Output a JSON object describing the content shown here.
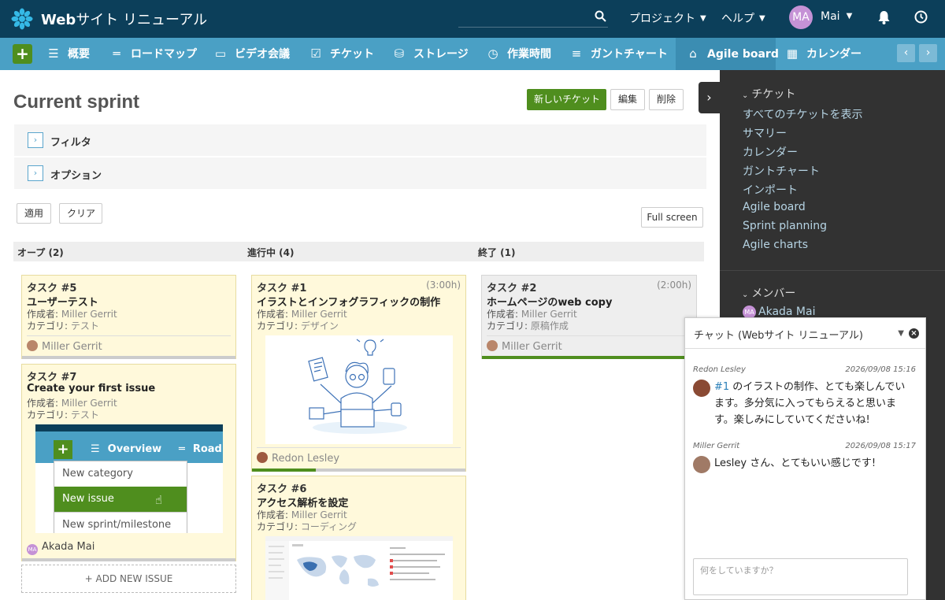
{
  "app": {
    "title_bold": "Web",
    "title_rest": "サイト リニューアル"
  },
  "header": {
    "nav_projects": "プロジェクト",
    "nav_help": "ヘルプ",
    "user_initials": "MA",
    "user_name": "Mai",
    "icons": [
      "search-icon",
      "bell-icon",
      "clock-icon"
    ]
  },
  "main_nav": {
    "add_label": "+",
    "tabs": [
      {
        "label": "概要",
        "icon": "list-icon"
      },
      {
        "label": "ロードマップ",
        "icon": "roadmap-icon"
      },
      {
        "label": "ビデオ会議",
        "icon": "video-icon"
      },
      {
        "label": "チケット",
        "icon": "checkbox-icon"
      },
      {
        "label": "ストレージ",
        "icon": "database-icon"
      },
      {
        "label": "作業時間",
        "icon": "clock-icon"
      },
      {
        "label": "ガントチャート",
        "icon": "gantt-icon"
      },
      {
        "label": "Agile board",
        "icon": "agile-icon",
        "active": true
      },
      {
        "label": "カレンダー",
        "icon": "calendar-icon"
      }
    ]
  },
  "page": {
    "title": "Current sprint",
    "new_ticket": "新しいチケット",
    "edit": "編集",
    "delete": "削除",
    "filter_label": "フィルタ",
    "options_label": "オプション",
    "apply": "適用",
    "clear": "クリア",
    "full_screen": "Full screen"
  },
  "board": {
    "columns": [
      "オープ (2)",
      "進行中 (4)",
      "終了 (1)"
    ],
    "author_label": "作成者: ",
    "category_label": "カテゴリ: ",
    "add_new_issue": "+ ADD NEW ISSUE",
    "cards": [
      {
        "tracker": "タスク #5",
        "subject": "ユーザーテスト",
        "author": "Miller Gerrit",
        "category": "テスト",
        "assignee": "Miller Gerrit",
        "done_ratio": 0
      },
      {
        "tracker": "タスク #7",
        "subject": "Create your first issue",
        "author": "Miller Gerrit",
        "category": "テスト",
        "assignee": "Akada Mai",
        "done_ratio": 0,
        "image": {
          "nav_label": "Overview",
          "nav_label2": "Road",
          "menu": [
            "New category",
            "New issue",
            "New sprint/milestone"
          ]
        }
      },
      {
        "tracker": "タスク #1",
        "subject": "イラストとインフォグラフィックの制作",
        "estimate": "(3:00h)",
        "author": "Miller Gerrit",
        "category": "デザイン",
        "assignee": "Redon Lesley",
        "done_ratio": 30
      },
      {
        "tracker": "タスク #6",
        "subject": "アクセス解析を設定",
        "author": "Miller Gerrit",
        "category": "コーディング"
      },
      {
        "tracker": "タスク #2",
        "subject": "ホームページのweb copy",
        "estimate": "(2:00h)",
        "author": "Miller Gerrit",
        "category": "原稿作成",
        "assignee": "Miller Gerrit",
        "done_ratio": 100
      }
    ]
  },
  "sidebar": {
    "tickets_heading": "チケット",
    "links": [
      "すべてのチケットを表示",
      "サマリー",
      "カレンダー",
      "ガントチャート",
      "インポート",
      "Agile board",
      "Sprint planning",
      "Agile charts"
    ],
    "members_heading": "メンバー",
    "member": "Akada Mai",
    "member_initials": "MA"
  },
  "chat": {
    "title": "チャット (Webサイト リニューアル)",
    "messages": [
      {
        "author": "Redon Lesley",
        "time": "2026/09/08 15:16",
        "link": "#1",
        "text": " のイラストの制作、とても楽しんでいます。多分気に入ってもらえると思います。楽しみにしていてくださいね!"
      },
      {
        "author": "Miller Gerrit",
        "time": "2026/09/08 15:17",
        "text": "Lesley さん、とてもいい感じです!"
      }
    ],
    "input_placeholder": "何をしていますか？"
  },
  "colors": {
    "header": "#0c3f5a",
    "nav": "#4aa0c5",
    "accent_green": "#4f8e1e",
    "card": "#fff9db",
    "sidebar": "#323232"
  }
}
